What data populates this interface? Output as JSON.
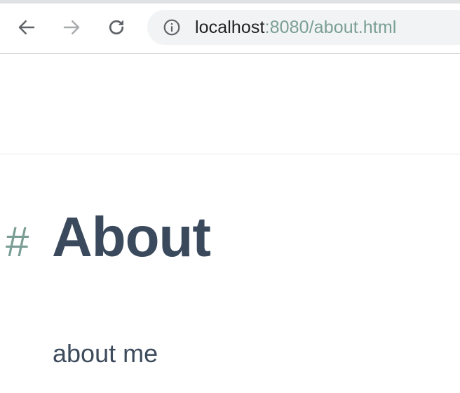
{
  "browser": {
    "back_icon": "arrow-left-icon",
    "forward_icon": "arrow-right-icon",
    "reload_icon": "reload-icon",
    "info_icon": "info-icon",
    "url_host": "localhost",
    "url_rest": ":8080/about.html"
  },
  "page": {
    "anchor": "#",
    "title": "About",
    "paragraph": "about me"
  },
  "colors": {
    "accent": "#7a9e95",
    "heading": "#3a4a5c",
    "text": "#3d4b5c"
  }
}
